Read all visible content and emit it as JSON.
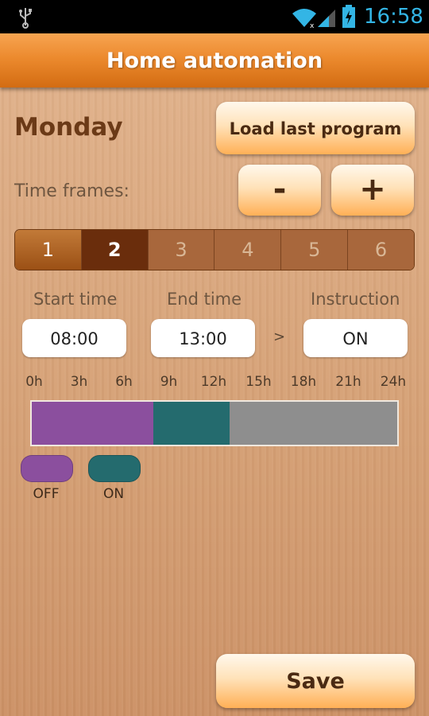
{
  "status_bar": {
    "time": "16:58",
    "icons": [
      "usb-icon",
      "wifi-icon",
      "signal-icon",
      "battery-icon"
    ],
    "clock_color": "#33b5e5"
  },
  "action_bar": {
    "title": "Home automation",
    "color": "#ec8a2e"
  },
  "day": "Monday",
  "load_button": "Load last program",
  "time_frames": {
    "label": "Time frames:",
    "minus": "-",
    "plus": "+",
    "tabs": [
      "1",
      "2",
      "3",
      "4",
      "5",
      "6"
    ],
    "selected": "2"
  },
  "columns": {
    "start_label": "Start time",
    "end_label": "End time",
    "instruction_label": "Instruction",
    "start_value": "08:00",
    "end_value": "13:00",
    "separator": ">",
    "instruction_value": "ON"
  },
  "timeline": {
    "hour_labels": [
      "0h",
      "3h",
      "6h",
      "9h",
      "12h",
      "15h",
      "18h",
      "21h",
      "24h"
    ],
    "segments": [
      {
        "state": "OFF",
        "from_hour": 0,
        "to_hour": 8,
        "color": "#8b4f9e"
      },
      {
        "state": "ON",
        "from_hour": 8,
        "to_hour": 13,
        "color": "#246b6e"
      },
      {
        "state": "unset",
        "from_hour": 13,
        "to_hour": 24,
        "color": "#8e8e8e"
      }
    ]
  },
  "legend": [
    {
      "label": "OFF",
      "color": "#8b4f9e"
    },
    {
      "label": "ON",
      "color": "#246b6e"
    }
  ],
  "save_button": "Save"
}
